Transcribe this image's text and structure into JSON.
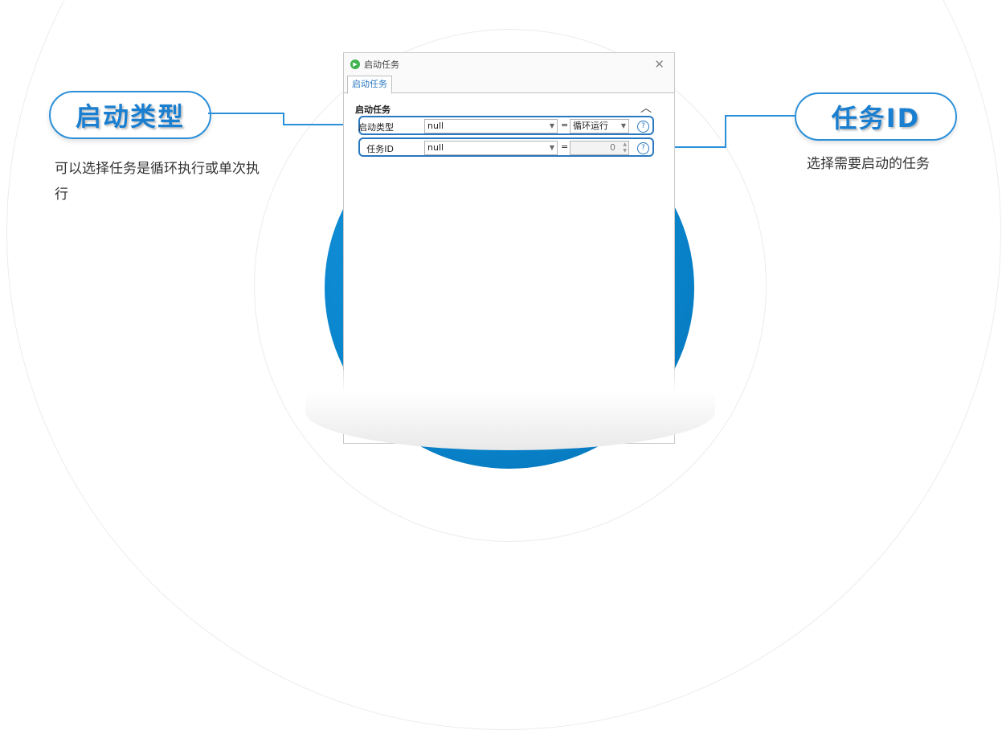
{
  "callouts": {
    "left": {
      "title": "启动类型",
      "desc": "可以选择任务是循环执行或单次执行"
    },
    "right": {
      "title": "任务ID",
      "desc": "选择需要启动的任务"
    }
  },
  "dialog": {
    "title": "启动任务",
    "tab": "启动任务",
    "section_title": "启动任务",
    "rows": [
      {
        "label": "启动类型",
        "select_value": "null",
        "eq": "=",
        "right_value": "循环运行",
        "help": "?"
      },
      {
        "label": "任务ID",
        "select_value": "null",
        "eq": "=",
        "right_value": "0",
        "help": "?"
      }
    ]
  },
  "icons": {
    "title_icon": "play-icon",
    "close": "close-icon",
    "collapse": "chevron-up-icon",
    "help": "help-icon"
  },
  "colors": {
    "accent": "#2b90d9",
    "brand_blue": "#0a86cf",
    "title_icon": "#3fb34f"
  }
}
